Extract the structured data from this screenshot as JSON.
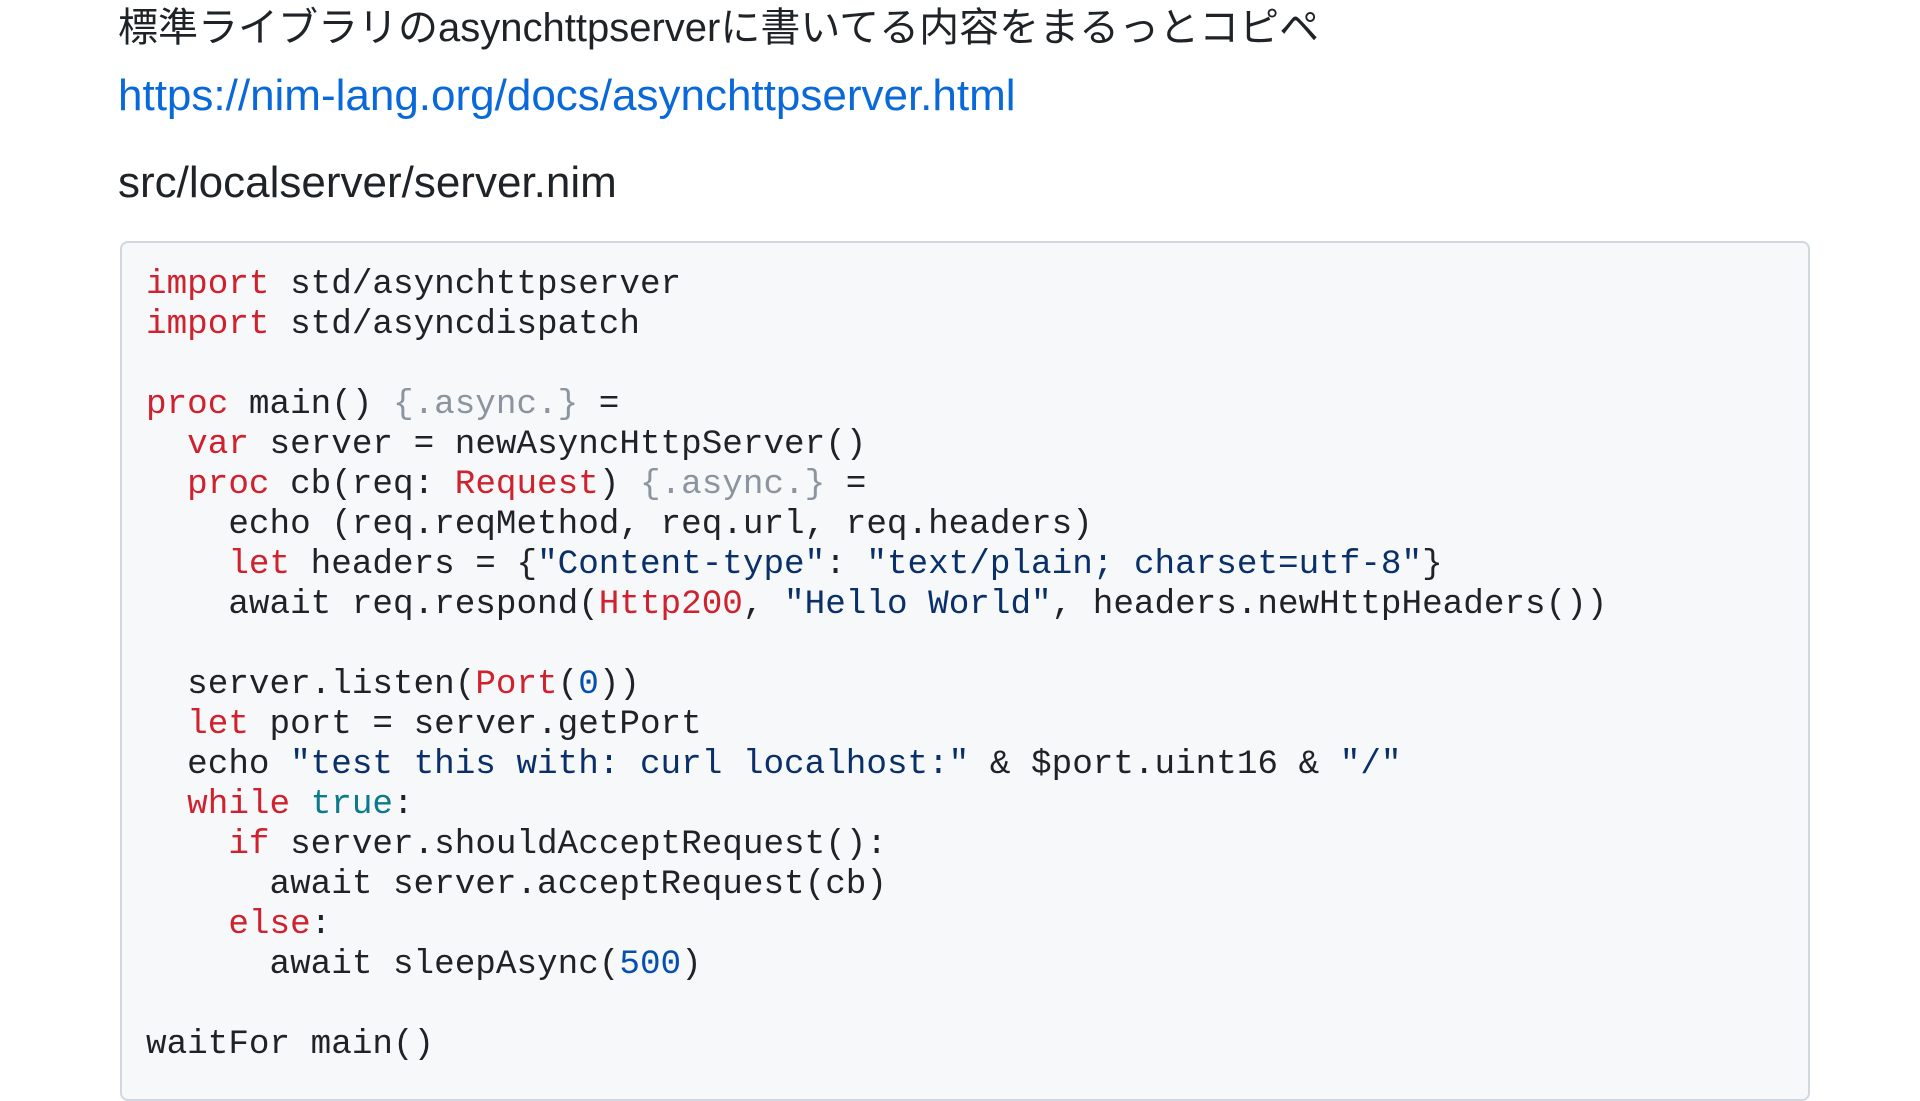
{
  "intro_text": "標準ライブラリのasynchttpserverに書いてる内容をまるっとコピペ",
  "doc_link": {
    "text": "https://nim-lang.org/docs/asynchttpserver.html"
  },
  "filename": "src/localserver/server.nim",
  "code_lines": [
    [
      {
        "t": "import",
        "c": "kw"
      },
      {
        "t": " std/asynchttpserver"
      }
    ],
    [
      {
        "t": "import",
        "c": "kw"
      },
      {
        "t": " std/asyncdispatch"
      }
    ],
    [],
    [
      {
        "t": "proc",
        "c": "kw"
      },
      {
        "t": " main() "
      },
      {
        "t": "{.async.}",
        "c": "pragma"
      },
      {
        "t": " ="
      }
    ],
    [
      {
        "t": "  "
      },
      {
        "t": "var",
        "c": "kw"
      },
      {
        "t": " server = newAsyncHttpServer()"
      }
    ],
    [
      {
        "t": "  "
      },
      {
        "t": "proc",
        "c": "kw"
      },
      {
        "t": " cb(req: "
      },
      {
        "t": "Request",
        "c": "kw"
      },
      {
        "t": ") "
      },
      {
        "t": "{.async.}",
        "c": "pragma"
      },
      {
        "t": " ="
      }
    ],
    [
      {
        "t": "    echo (req.reqMethod, req.url, req.headers)"
      }
    ],
    [
      {
        "t": "    "
      },
      {
        "t": "let",
        "c": "kw"
      },
      {
        "t": " headers = {"
      },
      {
        "t": "\"Content-type\"",
        "c": "str"
      },
      {
        "t": ": "
      },
      {
        "t": "\"text/plain; charset=utf-8\"",
        "c": "str"
      },
      {
        "t": "}"
      }
    ],
    [
      {
        "t": "    await req.respond("
      },
      {
        "t": "Http200",
        "c": "kw"
      },
      {
        "t": ", "
      },
      {
        "t": "\"Hello World\"",
        "c": "str"
      },
      {
        "t": ", headers.newHttpHeaders())"
      }
    ],
    [],
    [
      {
        "t": "  server.listen("
      },
      {
        "t": "Port",
        "c": "kw"
      },
      {
        "t": "("
      },
      {
        "t": "0",
        "c": "num"
      },
      {
        "t": "))"
      }
    ],
    [
      {
        "t": "  "
      },
      {
        "t": "let",
        "c": "kw"
      },
      {
        "t": " port = server.getPort"
      }
    ],
    [
      {
        "t": "  echo "
      },
      {
        "t": "\"test this with: curl localhost:\"",
        "c": "str"
      },
      {
        "t": " & $port.uint16 & "
      },
      {
        "t": "\"/\"",
        "c": "str"
      }
    ],
    [
      {
        "t": "  "
      },
      {
        "t": "while",
        "c": "kw"
      },
      {
        "t": " "
      },
      {
        "t": "true",
        "c": "bool"
      },
      {
        "t": ":"
      }
    ],
    [
      {
        "t": "    "
      },
      {
        "t": "if",
        "c": "kw"
      },
      {
        "t": " server.shouldAcceptRequest():"
      }
    ],
    [
      {
        "t": "      await server.acceptRequest(cb)"
      }
    ],
    [
      {
        "t": "    "
      },
      {
        "t": "else",
        "c": "kw"
      },
      {
        "t": ":"
      }
    ],
    [
      {
        "t": "      await sleepAsync("
      },
      {
        "t": "500",
        "c": "num"
      },
      {
        "t": ")"
      }
    ],
    [],
    [
      {
        "t": "waitFor main()"
      }
    ]
  ]
}
